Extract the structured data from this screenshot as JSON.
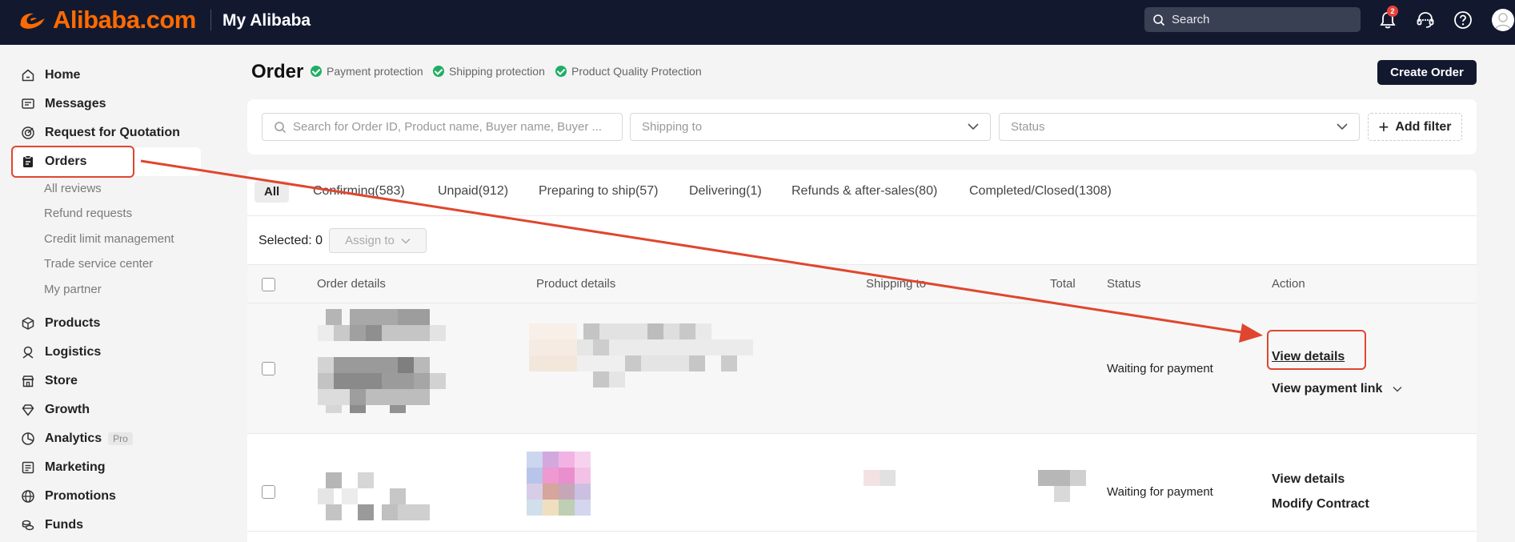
{
  "header": {
    "logo_text": "Alibaba.com",
    "app_title": "My Alibaba",
    "search_placeholder": "Search",
    "notification_count": "2",
    "brand_color": "#ff6a00",
    "bar_color": "#12192f"
  },
  "sidebar": {
    "items": [
      {
        "label": "Home",
        "icon": "home-icon"
      },
      {
        "label": "Messages",
        "icon": "message-icon"
      },
      {
        "label": "Request for Quotation",
        "icon": "target-icon"
      },
      {
        "label": "Orders",
        "icon": "clipboard-icon",
        "active": true
      },
      {
        "label": "Products",
        "icon": "box-icon"
      },
      {
        "label": "Logistics",
        "icon": "truck-icon"
      },
      {
        "label": "Store",
        "icon": "store-icon"
      },
      {
        "label": "Growth",
        "icon": "diamond-icon"
      },
      {
        "label": "Analytics",
        "icon": "pie-icon",
        "tag": "Pro"
      },
      {
        "label": "Marketing",
        "icon": "billboard-icon"
      },
      {
        "label": "Promotions",
        "icon": "globe-icon"
      },
      {
        "label": "Funds",
        "icon": "coins-icon"
      }
    ],
    "orders_sub": [
      "All reviews",
      "Refund requests",
      "Credit limit management",
      "Trade service center",
      "My partner"
    ]
  },
  "page": {
    "title": "Order",
    "protections": [
      "Payment protection",
      "Shipping protection",
      "Product Quality Protection"
    ],
    "create_button": "Create Order"
  },
  "filters": {
    "search_placeholder": "Search for Order ID, Product name, Buyer name, Buyer ...",
    "shipping_placeholder": "Shipping to",
    "status_placeholder": "Status",
    "add_filter": "Add filter"
  },
  "tabs": [
    "All",
    "Confirming(583)",
    "Unpaid(912)",
    "Preparing to ship(57)",
    "Delivering(1)",
    "Refunds & after-sales(80)",
    "Completed/Closed(1308)"
  ],
  "selection": {
    "label": "Selected: 0",
    "assign": "Assign to"
  },
  "table": {
    "headers": [
      "Order details",
      "Product details",
      "Shipping to",
      "Total",
      "Status",
      "Action"
    ],
    "rows": [
      {
        "status": "Waiting for payment",
        "actions": [
          "View details",
          "View payment link"
        ]
      },
      {
        "status": "Waiting for payment",
        "actions": [
          "View details",
          "Modify Contract"
        ]
      }
    ]
  },
  "annotation_color": "#e0462f"
}
